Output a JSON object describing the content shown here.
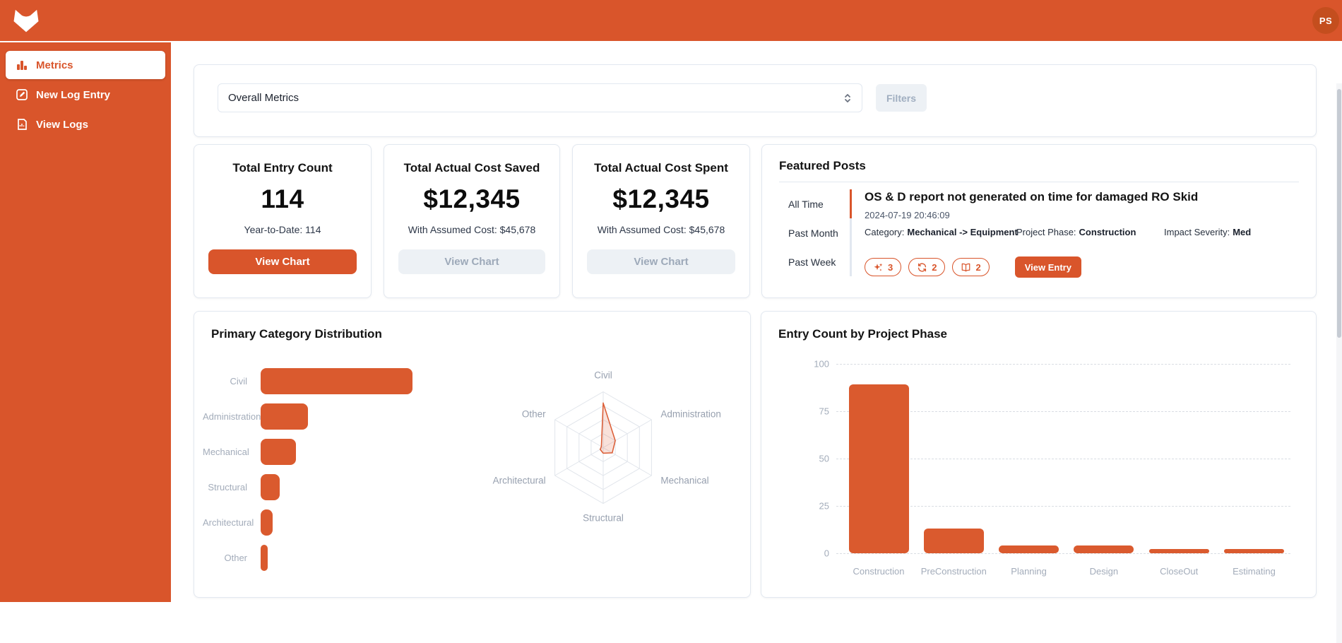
{
  "header": {
    "avatar_initials": "PS"
  },
  "sidebar": {
    "items": [
      {
        "label": "Metrics",
        "active": true
      },
      {
        "label": "New Log Entry",
        "active": false
      },
      {
        "label": "View Logs",
        "active": false
      }
    ]
  },
  "filter_bar": {
    "metric_select_value": "Overall Metrics",
    "filters_button_label": "Filters"
  },
  "stat_cards": [
    {
      "title": "Total Entry Count",
      "value": "114",
      "subtitle": "Year-to-Date: 114",
      "button_label": "View Chart",
      "button_enabled": true
    },
    {
      "title": "Total Actual Cost Saved",
      "value": "$12,345",
      "subtitle": "With Assumed Cost: $45,678",
      "button_label": "View Chart",
      "button_enabled": false
    },
    {
      "title": "Total Actual Cost Spent",
      "value": "$12,345",
      "subtitle": "With Assumed Cost: $45,678",
      "button_label": "View Chart",
      "button_enabled": false
    }
  ],
  "featured_posts": {
    "title": "Featured Posts",
    "tabs": [
      {
        "label": "All Time",
        "active": true
      },
      {
        "label": "Past Month",
        "active": false
      },
      {
        "label": "Past Week",
        "active": false
      }
    ],
    "post": {
      "title": "OS & D report not generated on time for damaged RO Skid",
      "timestamp": "2024-07-19 20:46:09",
      "category_label": "Category:",
      "category_value": "Mechanical -> Equipment",
      "phase_label": "Project Phase:",
      "phase_value": "Construction",
      "severity_label": "Impact Severity:",
      "severity_value": "Med",
      "badges": [
        {
          "icon": "sparkles-icon",
          "count": "3"
        },
        {
          "icon": "refresh-icon",
          "count": "2"
        },
        {
          "icon": "book-icon",
          "count": "2"
        }
      ],
      "view_entry_label": "View Entry"
    }
  },
  "chart_data": [
    {
      "type": "bar",
      "orientation": "horizontal",
      "title": "Primary Category Distribution",
      "categories": [
        "Civil",
        "Administration",
        "Mechanical",
        "Structural",
        "Architectural",
        "Other"
      ],
      "values": [
        64,
        20,
        15,
        8,
        5,
        3
      ],
      "xlim": [
        0,
        64
      ],
      "grid": false,
      "bar_color": "#DA5A2E"
    },
    {
      "type": "radar",
      "title": "Primary Category Distribution (radar)",
      "categories": [
        "Civil",
        "Administration",
        "Mechanical",
        "Structural",
        "Architectural",
        "Other"
      ],
      "values": [
        64,
        20,
        15,
        8,
        5,
        3
      ],
      "max": 80,
      "rings": 4,
      "stroke_color": "#DB5B33",
      "fill_color": "rgba(219,91,50,0.18)"
    },
    {
      "type": "bar",
      "orientation": "vertical",
      "title": "Entry Count by Project Phase",
      "categories": [
        "Construction",
        "PreConstruction",
        "Planning",
        "Design",
        "CloseOut",
        "Estimating"
      ],
      "values": [
        89,
        13,
        4,
        4,
        2,
        2
      ],
      "yticks": [
        0,
        25,
        50,
        75,
        100
      ],
      "ylim": [
        0,
        100
      ],
      "grid": "dashed-horizontal",
      "bar_color": "#DA5A2E"
    }
  ],
  "colors": {
    "primary": "#D9552B",
    "bar": "#DA5A2E",
    "card_border": "#E2E8F0",
    "muted_text": "#A3ACBA",
    "disabled_bg": "#EDF1F5",
    "disabled_text": "#9DA9B9",
    "avatar_bg": "#C44E1E"
  }
}
